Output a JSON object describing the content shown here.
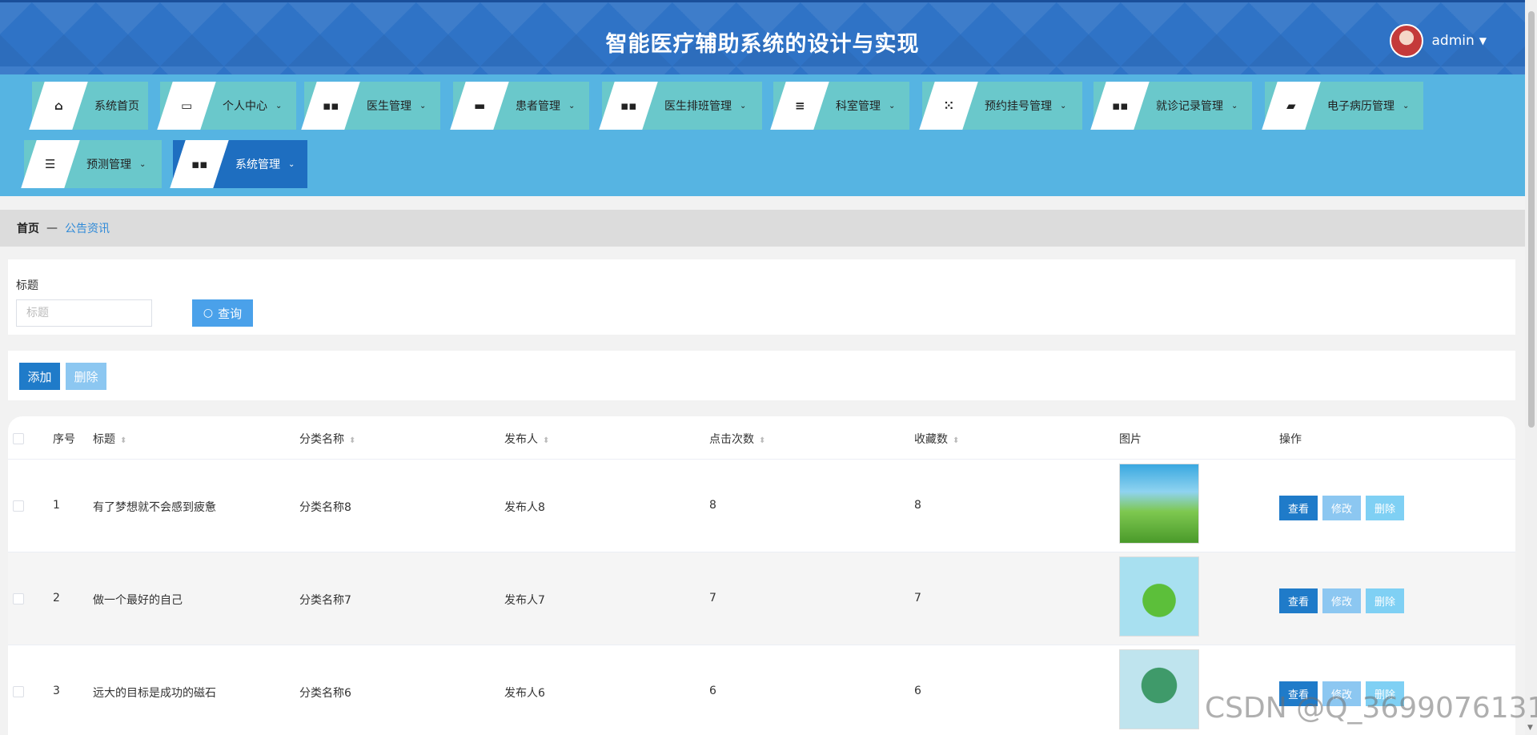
{
  "header": {
    "title": "智能医疗辅助系统的设计与实现",
    "username": "admin"
  },
  "nav": {
    "items": [
      {
        "label": "系统首页",
        "icon": "home-icon",
        "glyph": "⌂",
        "has_chevron": false
      },
      {
        "label": "个人中心",
        "icon": "card-icon",
        "glyph": "▭",
        "has_chevron": true
      },
      {
        "label": "医生管理",
        "icon": "grid-icon",
        "glyph": "▪▪",
        "has_chevron": true
      },
      {
        "label": "患者管理",
        "icon": "chat-icon",
        "glyph": "▬",
        "has_chevron": true
      },
      {
        "label": "医生排班管理",
        "icon": "grid-icon",
        "glyph": "▪▪",
        "has_chevron": true
      },
      {
        "label": "科室管理",
        "icon": "list-icon",
        "glyph": "≡",
        "has_chevron": true
      },
      {
        "label": "预约挂号管理",
        "icon": "apps-icon",
        "glyph": "⁙",
        "has_chevron": true
      },
      {
        "label": "就诊记录管理",
        "icon": "grid-icon",
        "glyph": "▪▪",
        "has_chevron": true
      },
      {
        "label": "电子病历管理",
        "icon": "briefcase-icon",
        "glyph": "▰",
        "has_chevron": true
      },
      {
        "label": "预测管理",
        "icon": "sliders-icon",
        "glyph": "☰",
        "has_chevron": true
      },
      {
        "label": "系统管理",
        "icon": "grid-icon",
        "glyph": "▪▪",
        "has_chevron": true,
        "active": true
      }
    ]
  },
  "breadcrumb": {
    "home": "首页",
    "separator": "—",
    "current": "公告资讯"
  },
  "search": {
    "label": "标题",
    "placeholder": "标题",
    "value": "",
    "button_label": "查询"
  },
  "actions": {
    "add_label": "添加",
    "delete_label": "删除"
  },
  "table": {
    "columns": [
      "序号",
      "标题",
      "分类名称",
      "发布人",
      "点击次数",
      "收藏数",
      "图片",
      "操作"
    ],
    "rows": [
      {
        "index": "1",
        "title": "有了梦想就不会感到疲惫",
        "category": "分类名称8",
        "publisher": "发布人8",
        "clicks": "8",
        "favorites": "8"
      },
      {
        "index": "2",
        "title": "做一个最好的自己",
        "category": "分类名称7",
        "publisher": "发布人7",
        "clicks": "7",
        "favorites": "7"
      },
      {
        "index": "3",
        "title": "远大的目标是成功的磁石",
        "category": "分类名称6",
        "publisher": "发布人6",
        "clicks": "6",
        "favorites": "6"
      }
    ],
    "op_view": "查看",
    "op_edit": "修改",
    "op_delete": "删除"
  },
  "watermark": "CSDN @Q_3699076131",
  "colors": {
    "header_bg": "#2f73c6",
    "nav_bg": "#56b4e2",
    "nav_item_bg": "#6ac8cb",
    "nav_active_bg": "#1e6ec0",
    "primary": "#1f7bc9",
    "primary_light": "#8cc7f1"
  }
}
